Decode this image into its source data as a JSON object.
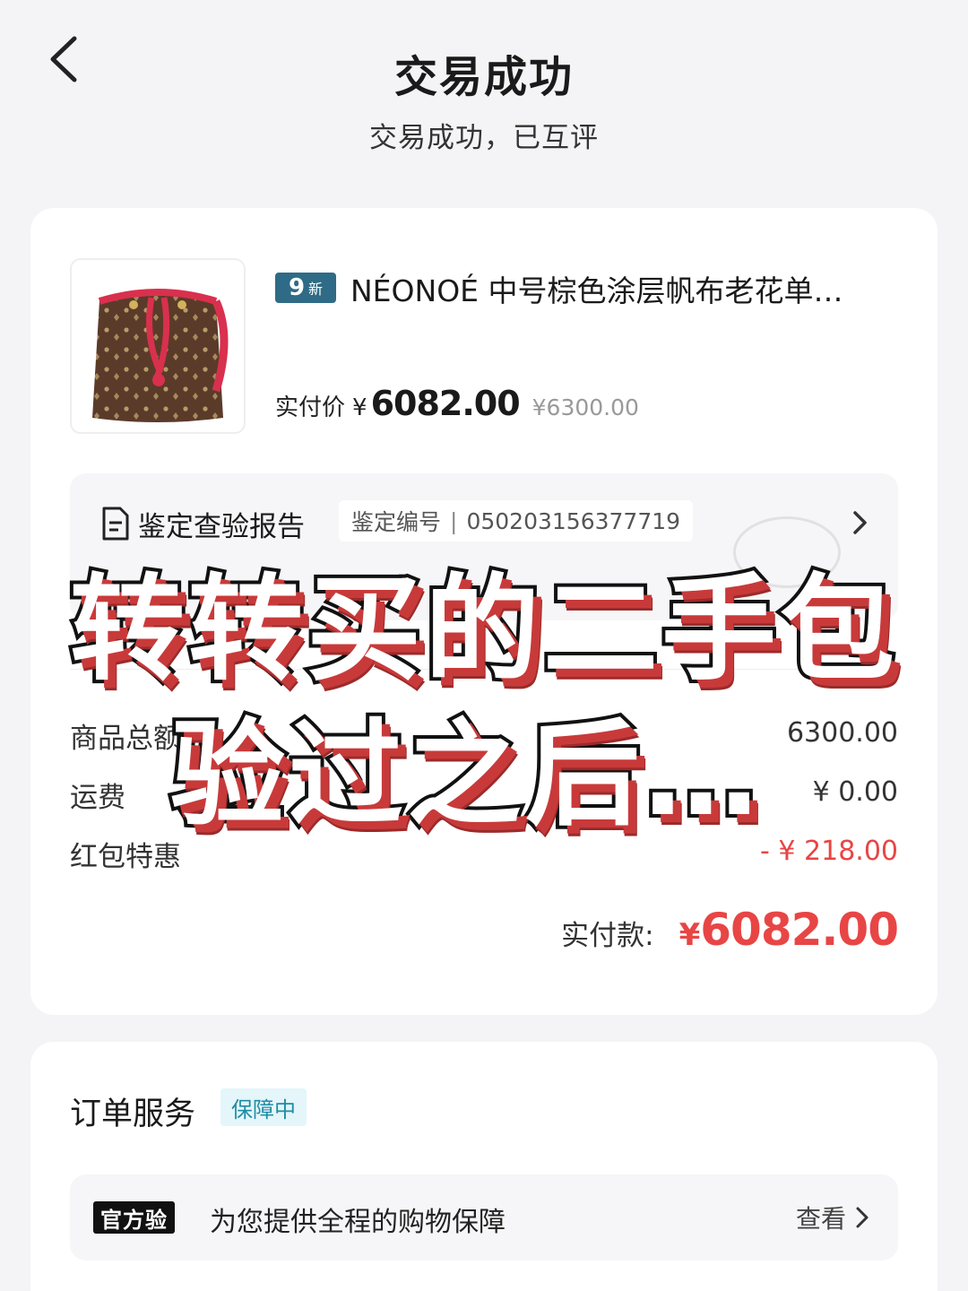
{
  "header": {
    "title": "交易成功",
    "subtitle": "交易成功，已互评"
  },
  "product": {
    "condition_number": "9",
    "condition_text": "新",
    "title": "NÉONOÉ 中号棕色涂层帆布老花单…",
    "paid_label": "实付价",
    "currency": "¥",
    "paid_price": "6082.00",
    "original_price": "¥6300.00"
  },
  "report": {
    "title": "鉴定查验报告",
    "number_label": "鉴定编号",
    "separator": "|",
    "number": "050203156377719"
  },
  "fees": [
    {
      "label": "商品总额",
      "value": "6300.00"
    },
    {
      "label": "运费",
      "value": "¥ 0.00"
    },
    {
      "label": "红包特惠",
      "value": "- ¥ 218.00"
    }
  ],
  "total": {
    "label": "实付款:",
    "currency": "¥",
    "value": "6082.00"
  },
  "service": {
    "title": "订单服务",
    "badge": "保障中",
    "tag": "官方验",
    "text": "为您提供全程的购物保障",
    "link": "查看"
  },
  "overlay": {
    "line1": "转转买的二手包",
    "line2": "验过之后…"
  },
  "colors": {
    "accent_red": "#e84545",
    "badge_blue": "#2f6b86",
    "service_badge_bg": "#e4f6fa"
  }
}
